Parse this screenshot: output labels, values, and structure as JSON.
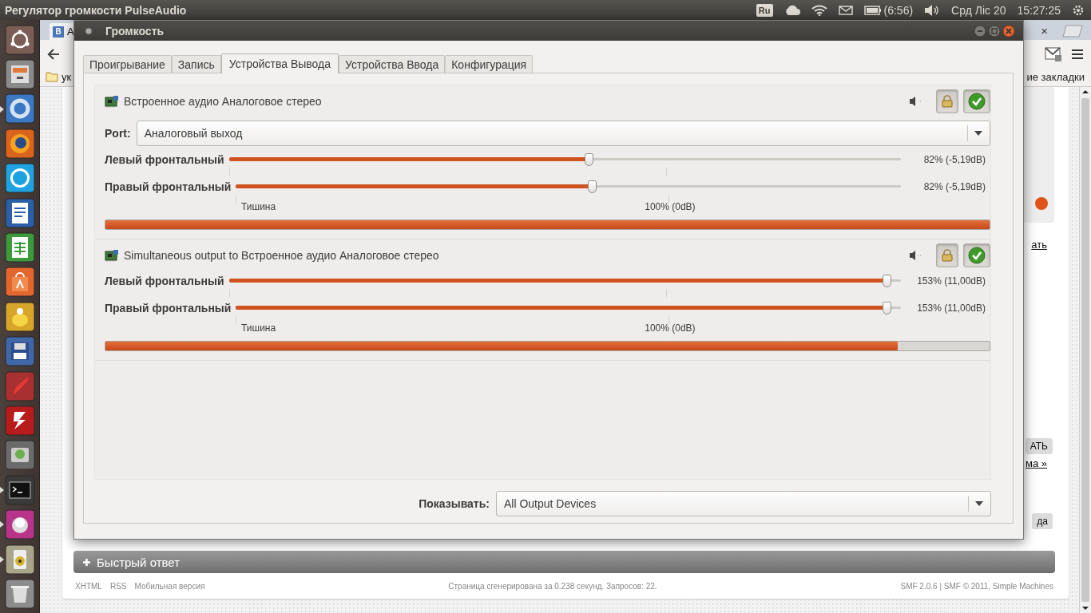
{
  "top_panel": {
    "title": "Регулятор громкости PulseAudio",
    "keyboard_layout": "Ru",
    "battery_time": "(6:56)",
    "date": "Срд Ліс 20",
    "time": "15:27:25"
  },
  "launcher": [
    {
      "running": false
    },
    {
      "running": false
    },
    {
      "running": true
    },
    {
      "running": false
    },
    {
      "running": false
    },
    {
      "running": false
    },
    {
      "running": false
    },
    {
      "running": false
    },
    {
      "running": false
    },
    {
      "running": false
    },
    {
      "running": false
    },
    {
      "running": false
    },
    {
      "running": false
    },
    {
      "running": true
    },
    {
      "running": true
    },
    {
      "running": true
    },
    {
      "running": false
    }
  ],
  "browser": {
    "tab": {
      "favicon_letter": "В",
      "title": "А"
    },
    "tab_close": "×",
    "bookmark_folder": "ук",
    "bookmarks_end": "ие закладки",
    "page_fragments": [
      {
        "kind": "link",
        "text": "ать"
      },
      {
        "kind": "button",
        "text": "АТЬ"
      },
      {
        "kind": "link",
        "text": "ма »"
      },
      {
        "kind": "button",
        "text": "да"
      }
    ],
    "quick_reply": "Быстрый ответ",
    "footer_links": [
      "XHTML",
      "RSS",
      "Мобильная версия"
    ],
    "footer_center": "Страница сгенерирована за 0.238 секунд. Запросов: 22.",
    "footer_right": "SMF 2.0.6 | SMF © 2011, Simple Machines"
  },
  "dialog": {
    "title": "Громкость",
    "tabs": [
      {
        "label": "Проигрывание",
        "selected": false
      },
      {
        "label": "Запись",
        "selected": false
      },
      {
        "label": "Устройства Вывода",
        "selected": true
      },
      {
        "label": "Устройства Ввода",
        "selected": false
      },
      {
        "label": "Конфигурация",
        "selected": false
      }
    ],
    "devices": [
      {
        "name": "Встроенное аудио Аналоговое стерео",
        "locked": true,
        "is_default": true,
        "port_label": "Port:",
        "port": "Аналоговый выход",
        "channels": [
          {
            "name": "Левый фронтальный",
            "level": 0.536,
            "reading": "82% (-5,19dB)"
          },
          {
            "name": "Правый фронтальный",
            "level": 0.536,
            "reading": "82% (-5,19dB)"
          }
        ],
        "scale_low": "Тишина",
        "scale_unity": "100% (0dB)",
        "meter": {
          "level": 1.0
        }
      },
      {
        "name": "Simultaneous output to Встроенное аудио Аналоговое стерео",
        "locked": true,
        "is_default": true,
        "channels": [
          {
            "name": "Левый фронтальный",
            "level": 0.98,
            "reading": "153% (11,00dB)"
          },
          {
            "name": "Правый фронтальный",
            "level": 0.98,
            "reading": "153% (11,00dB)"
          }
        ],
        "scale_low": "Тишина",
        "scale_unity": "100% (0dB)",
        "meter": {
          "level": 0.896
        }
      }
    ],
    "show_label": "Показывать:",
    "show_value": "All Output Devices"
  }
}
